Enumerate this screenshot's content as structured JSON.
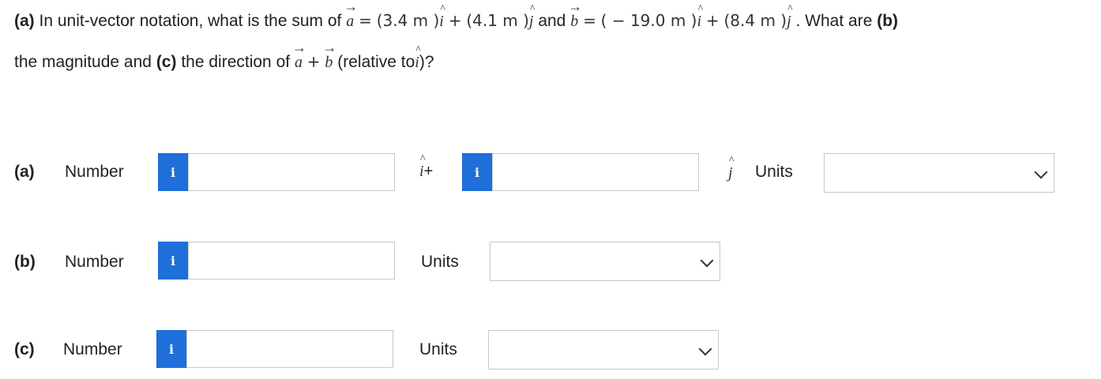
{
  "question": {
    "part_a_prefix": "(a)",
    "line1_text": "In unit-vector notation, what is the sum of",
    "vec_a": "a",
    "vec_b": "b",
    "eq": "=",
    "a_x": "(3.4 m )",
    "i_hat": "i",
    "plus": "+",
    "a_y": "(4.1 m )",
    "j_hat": "j",
    "and": "and",
    "b_x": "( − 19.0 m )",
    "b_y": "(8.4 m )",
    "what_are": ". What are",
    "part_b_prefix": "(b)",
    "line2_text": "the magnitude and",
    "part_c_prefix": "(c)",
    "line2_text2": "the direction of",
    "relative": "(relative to",
    "end": ")?"
  },
  "parts": {
    "a": {
      "label": "(a)",
      "number_label": "Number",
      "info_icon": "i",
      "i_plus": "+",
      "unit_vec_i": "i",
      "info_icon2": "i",
      "unit_vec_j": "j",
      "units_label": "Units",
      "value_i": "",
      "value_j": "",
      "units_value": ""
    },
    "b": {
      "label": "(b)",
      "number_label": "Number",
      "info_icon": "i",
      "units_label": "Units",
      "value": "",
      "units_value": ""
    },
    "c": {
      "label": "(c)",
      "number_label": "Number",
      "info_icon": "i",
      "units_label": "Units",
      "value": "",
      "units_value": ""
    }
  },
  "colors": {
    "info_blue": "#1e6fd9",
    "field_border": "#c8c8c8"
  },
  "icons": [
    "info-icon",
    "chevron-down-icon"
  ]
}
